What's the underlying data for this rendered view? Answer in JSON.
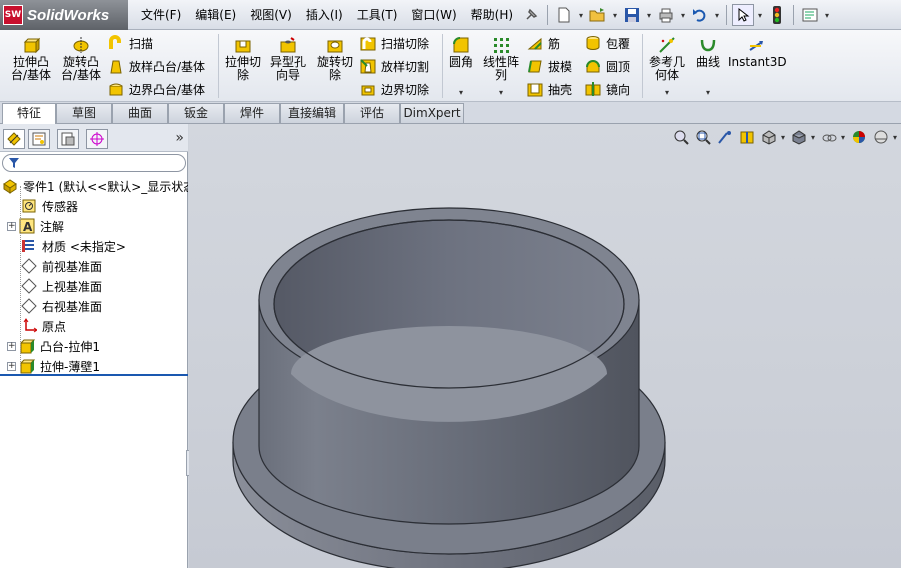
{
  "app": {
    "logo_text": "SW",
    "name": "SolidWorks"
  },
  "menu": [
    "文件(F)",
    "编辑(E)",
    "视图(V)",
    "插入(I)",
    "工具(T)",
    "窗口(W)",
    "帮助(H)"
  ],
  "command_manager": {
    "extrude_boss": [
      "拉伸凸",
      "台/基体"
    ],
    "revolve_boss": [
      "旋转凸",
      "台/基体"
    ],
    "sweep": "扫描",
    "loft_boss": "放样凸台/基体",
    "boundary_boss": "边界凸台/基体",
    "extrude_cut": [
      "拉伸切",
      "除"
    ],
    "hole_wizard": [
      "异型孔",
      "向导"
    ],
    "revolve_cut": [
      "旋转切",
      "除"
    ],
    "swept_cut": "扫描切除",
    "lofted_cut": "放样切割",
    "boundary_cut": "边界切除",
    "fillet": "圆角",
    "linear_pattern": [
      "线性阵",
      "列"
    ],
    "rib": "筋",
    "draft": "拔模",
    "shell": "抽壳",
    "wrap": "包覆",
    "dome": "圆顶",
    "mirror": "镜向",
    "ref_geometry": [
      "参考几",
      "何体"
    ],
    "curves": "曲线",
    "instant3d": "Instant3D",
    "dropdown": "▾"
  },
  "tabs": [
    "特征",
    "草图",
    "曲面",
    "钣金",
    "焊件",
    "直接编辑",
    "评估",
    "DimXpert"
  ],
  "panel": {
    "expand": "»",
    "collapse": "‹"
  },
  "tree": {
    "root": "零件1 (默认<<默认>_显示状态",
    "items": [
      {
        "label": "传感器",
        "icon": "sensor-icon"
      },
      {
        "label": "注解",
        "icon": "annotation-icon",
        "expandable": true
      },
      {
        "label": "材质 <未指定>",
        "icon": "material-icon"
      },
      {
        "label": "前视基准面",
        "icon": "plane-icon"
      },
      {
        "label": "上视基准面",
        "icon": "plane-icon"
      },
      {
        "label": "右视基准面",
        "icon": "plane-icon"
      },
      {
        "label": "原点",
        "icon": "origin-icon"
      },
      {
        "label": "凸台-拉伸1",
        "icon": "extrude-icon",
        "expandable": true
      },
      {
        "label": "拉伸-薄壁1",
        "icon": "extrude-icon",
        "expandable": true
      }
    ]
  },
  "colors": {
    "model_face": "#656a76",
    "model_light": "#8d929d",
    "model_dark": "#4b4f58",
    "accent_yellow": "#f2c400",
    "rollback_bar": "#1a58b0"
  }
}
